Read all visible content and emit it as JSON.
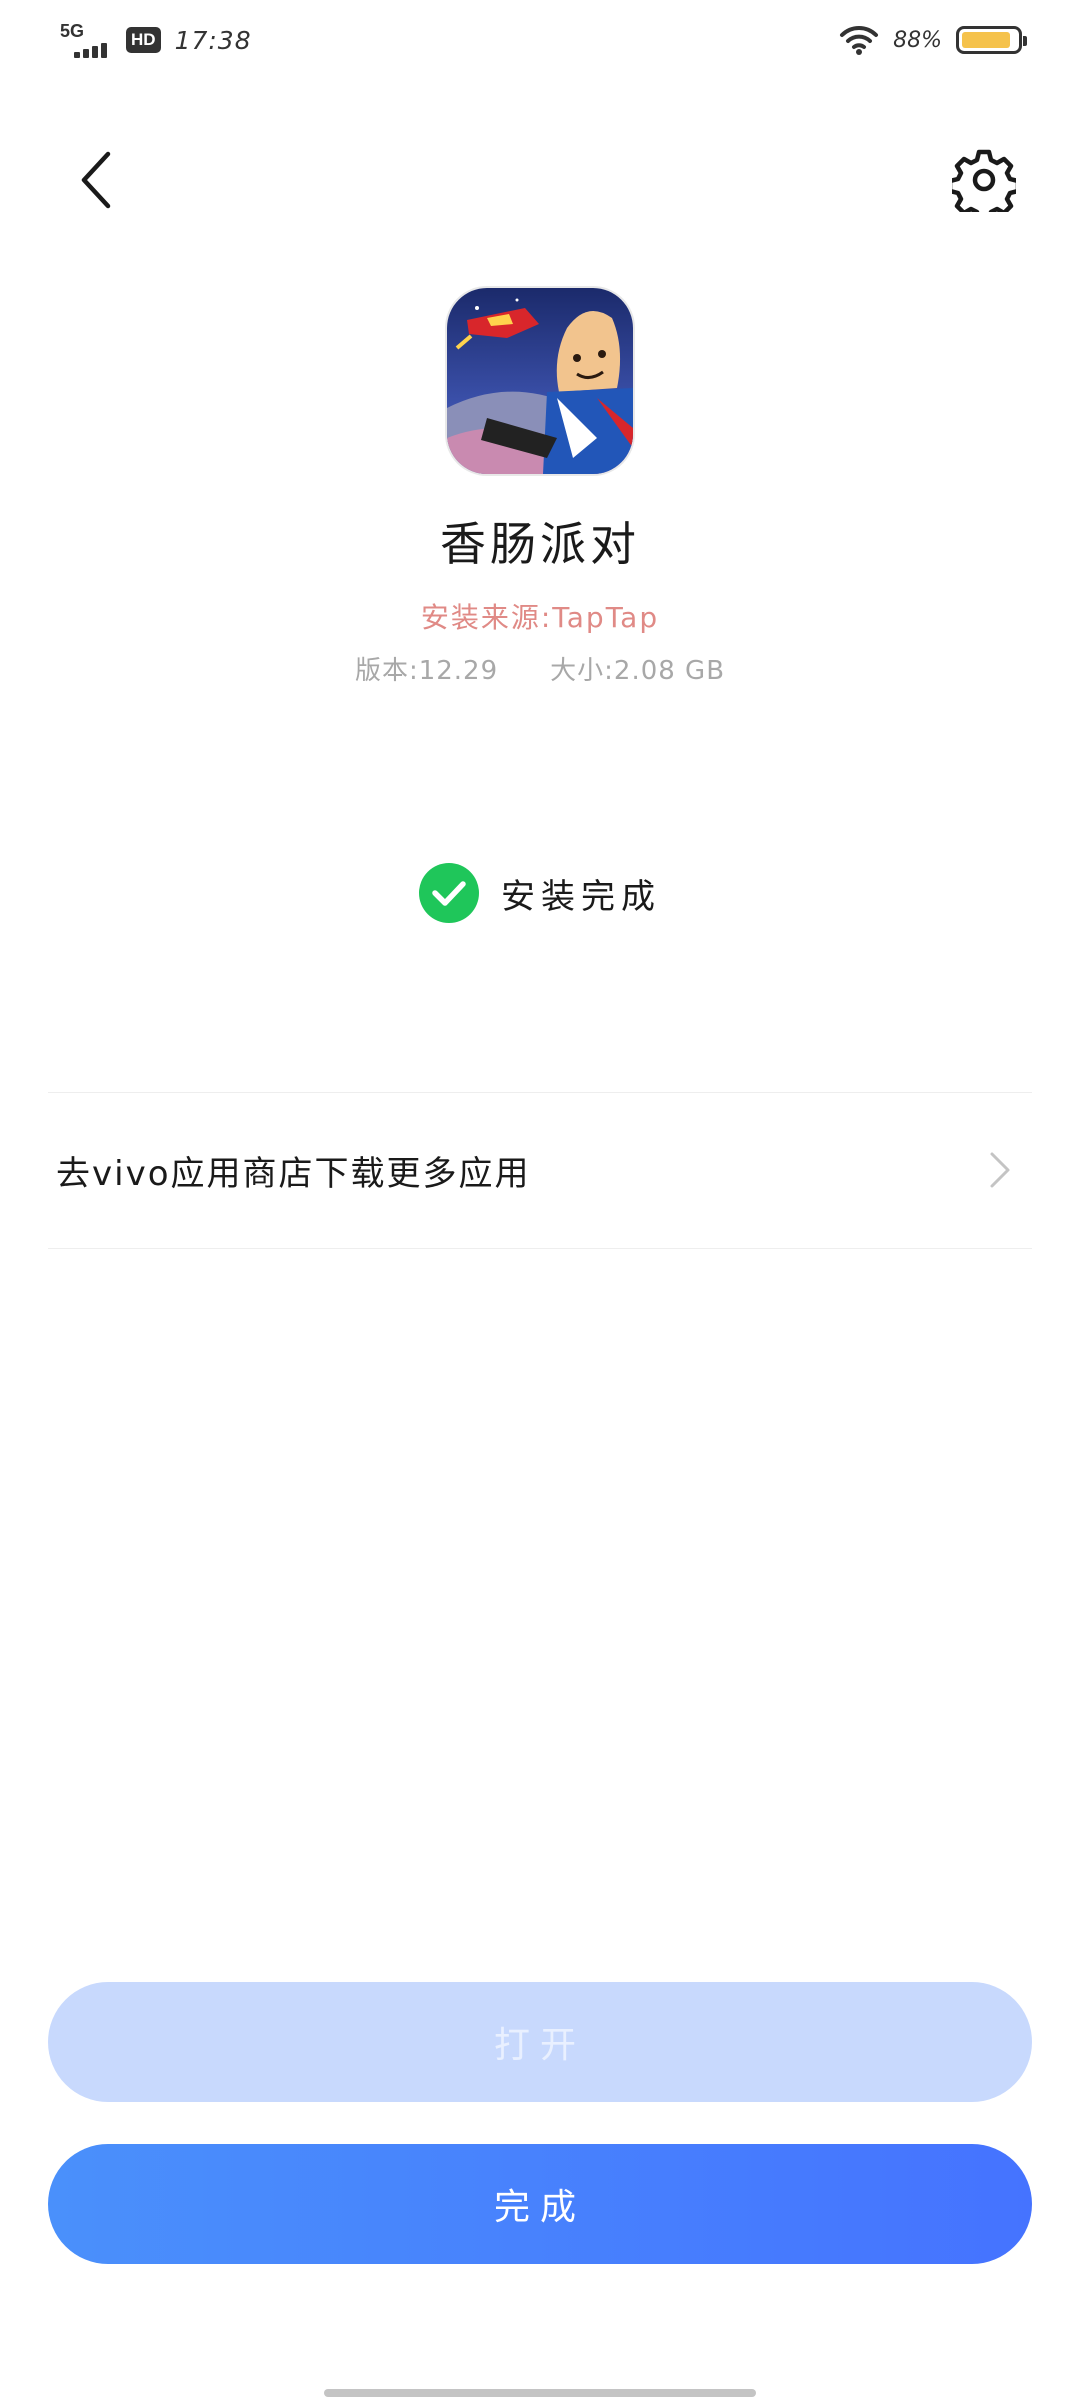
{
  "status_bar": {
    "network": "5G",
    "hd_badge": "HD",
    "time": "17:38",
    "battery_percent": "88%",
    "battery_level": 0.88,
    "icons": [
      "signal-icon",
      "wifi-icon",
      "battery-icon"
    ]
  },
  "header": {
    "back_icon": "chevron-left-icon",
    "settings_icon": "gear-icon"
  },
  "app": {
    "name": "香肠派对",
    "install_source": "安装来源:TapTap",
    "version": "版本:12.29",
    "size": "大小:2.08 GB"
  },
  "status": {
    "label": "安装完成",
    "icon": "check-circle-icon",
    "color": "#1fc65a"
  },
  "store_link": {
    "label": "去vivo应用商店下载更多应用",
    "icon": "chevron-right-icon"
  },
  "buttons": {
    "open_label": "打开",
    "done_label": "完成"
  },
  "colors": {
    "primary": "#4a80ff",
    "open_disabled": "#c8d9fd",
    "source_text": "#e08a86"
  }
}
